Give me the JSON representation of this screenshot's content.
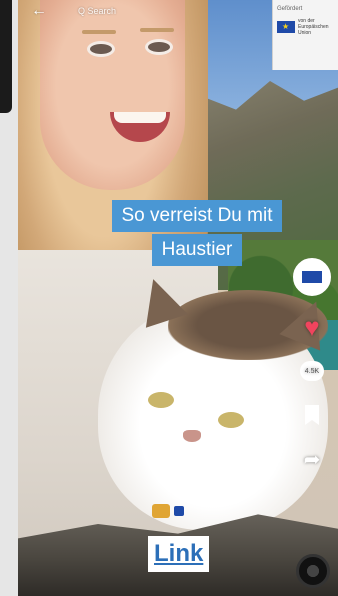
{
  "topbar": {
    "search_text": "Q Search"
  },
  "eu_badge": {
    "title": "Gefördert",
    "text": "von der Europäischen Union"
  },
  "caption": {
    "line1": "So verreist Du mit",
    "line2": "Haustier"
  },
  "rail": {
    "comment_count": "4.5K"
  },
  "link": {
    "label": "Link"
  },
  "colors": {
    "caption_bg": "#4a97d4",
    "link_text": "#2c6fb8",
    "like_heart": "#f0445e",
    "eu_blue": "#1f4aa8"
  },
  "icons": [
    "back-arrow-icon",
    "heart-icon",
    "comment-icon",
    "bookmark-icon",
    "share-icon",
    "music-disc-icon"
  ]
}
